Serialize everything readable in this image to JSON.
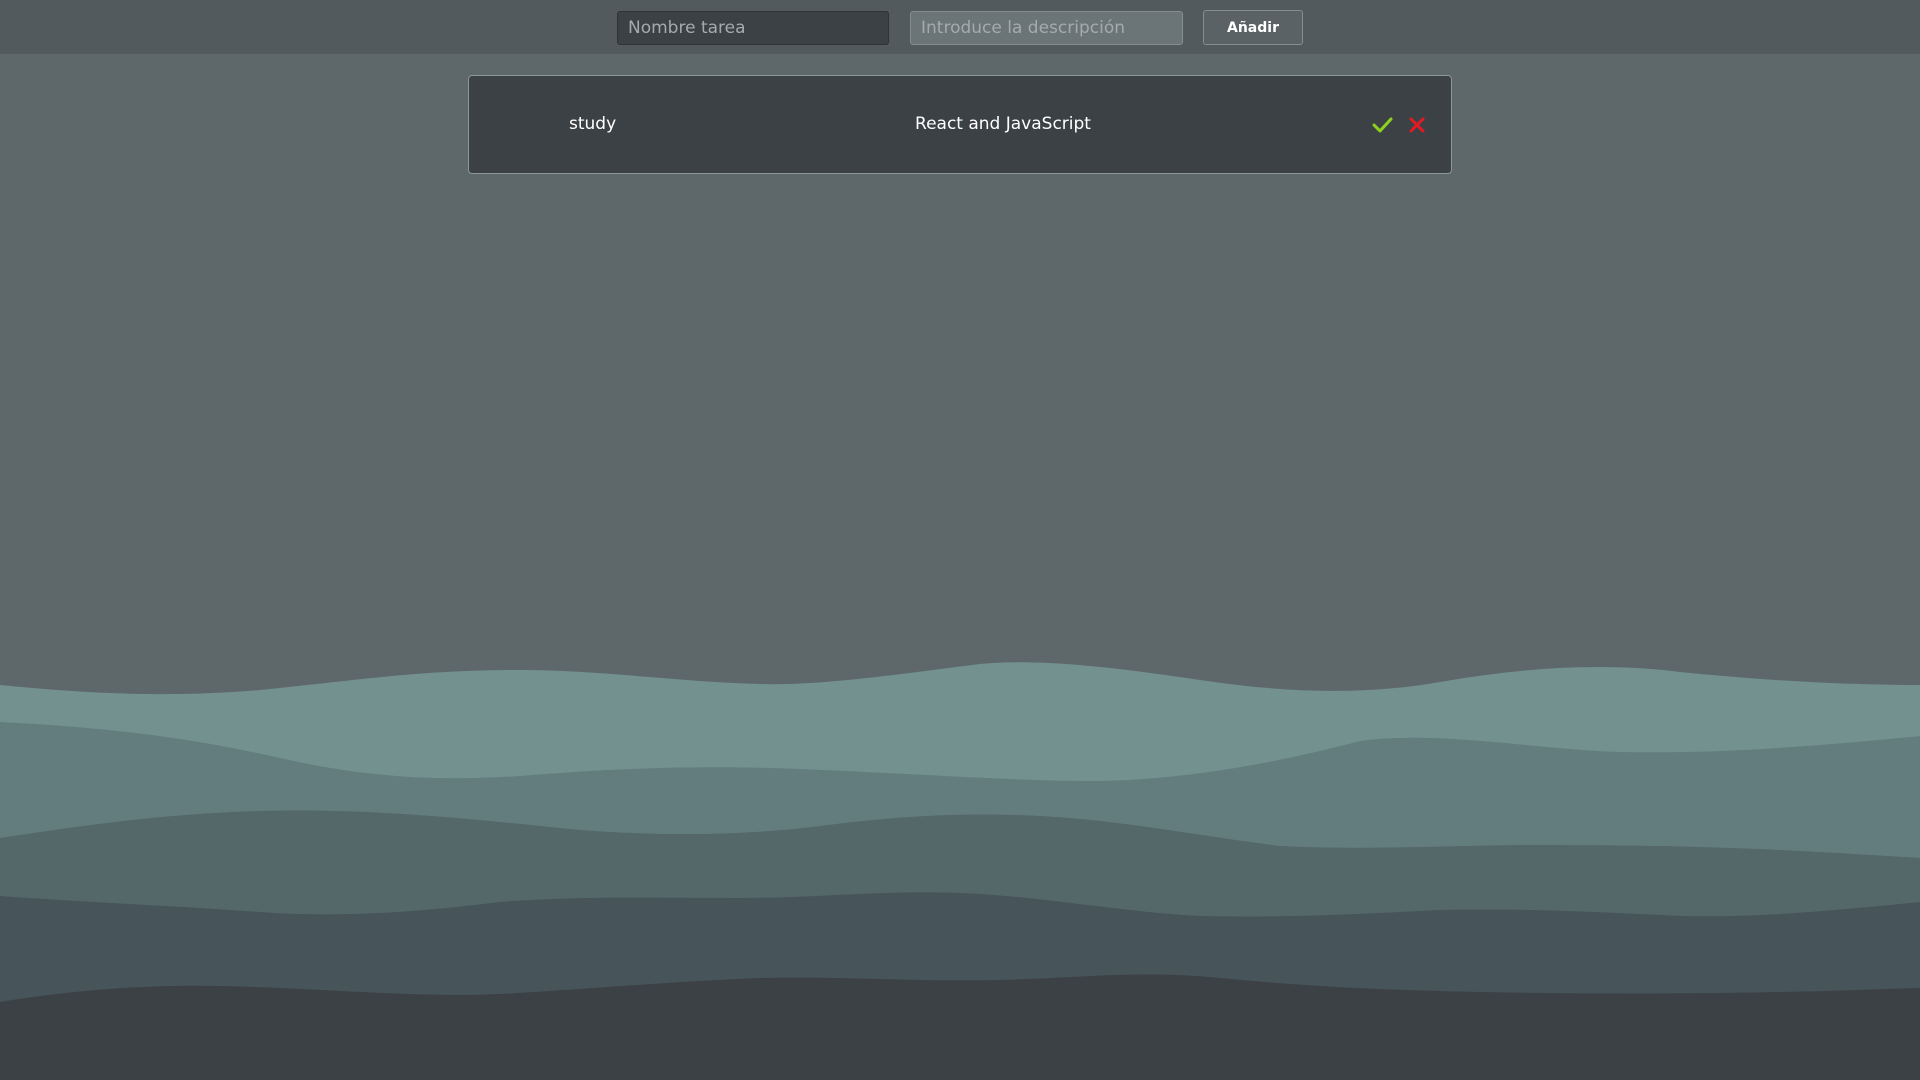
{
  "form": {
    "name_placeholder": "Nombre tarea",
    "name_value": "",
    "description_placeholder": "Introduce la descripción",
    "description_value": "",
    "add_label": "Añadir"
  },
  "tasks": [
    {
      "name": "study",
      "description": "React and JavaScript",
      "done_icon": "check-icon",
      "delete_icon": "close-icon"
    }
  ],
  "colors": {
    "background": "#5e686a",
    "card": "#3b4145",
    "check": "#8ed21f",
    "delete": "#e01b24",
    "waves": [
      "#72918f",
      "#637d7e",
      "#546769",
      "#47545a",
      "#3b4145"
    ]
  }
}
